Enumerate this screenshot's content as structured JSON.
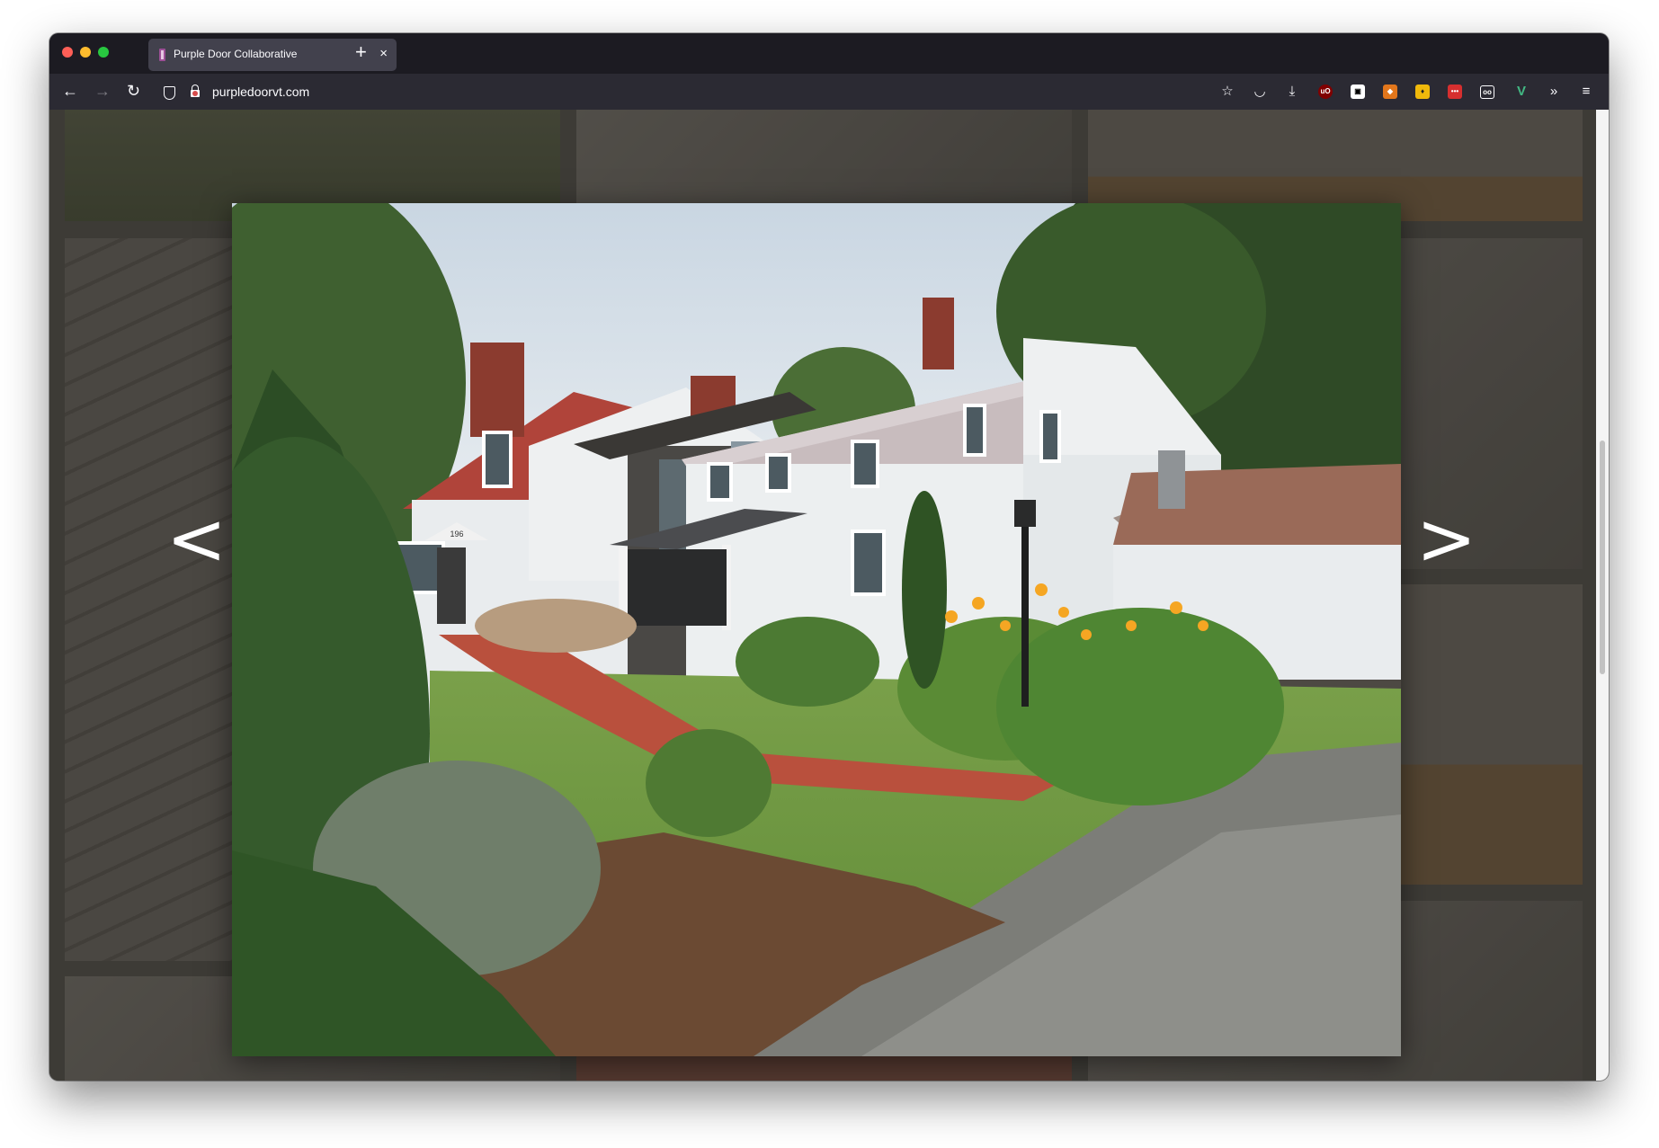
{
  "browser": {
    "tab": {
      "title": "Purple Door Collaborative"
    },
    "new_tab_label": "+",
    "close_tab_label": "×",
    "nav": {
      "back": "←",
      "forward": "→",
      "reload": "↻"
    },
    "url": "purpledoorvt.com",
    "toolbar_icons": [
      "bookmark-star-icon",
      "pocket-icon",
      "download-icon",
      "ublock-icon",
      "extension-icon",
      "metamask-icon",
      "extension-icon",
      "extension-icon",
      "extension-icon",
      "vue-devtools-icon",
      "overflow-icon",
      "menu-icon"
    ]
  },
  "lightbox": {
    "prev_label": "<",
    "next_label": ">",
    "house_number": "196"
  }
}
